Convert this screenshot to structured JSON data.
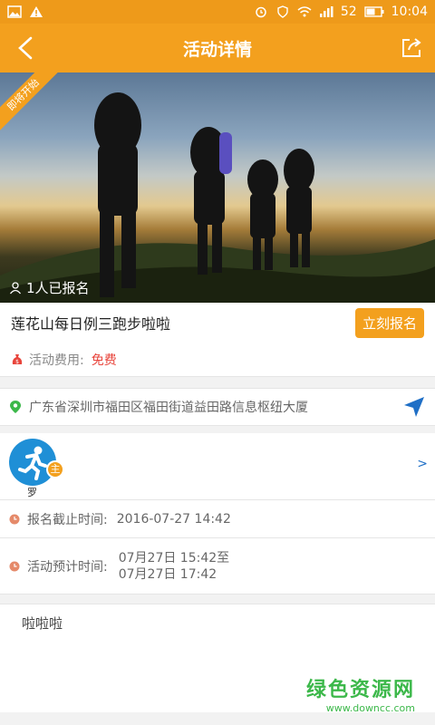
{
  "status_bar": {
    "battery": "52",
    "time": "10:04"
  },
  "header": {
    "title": "活动详情"
  },
  "hero": {
    "ribbon": "即将开始",
    "signed_count_text": "1人已报名"
  },
  "event": {
    "name": "莲花山每日例三跑步啦啦",
    "signup_label": "立刻报名",
    "fee_label": "活动费用:",
    "fee_value": "免费"
  },
  "location": {
    "address": "广东省深圳市福田区福田街道益田路信息枢纽大厦"
  },
  "host": {
    "badge": "主",
    "name": "罗",
    "chevron": ">"
  },
  "deadline": {
    "label": "报名截止时间:",
    "value": "2016-07-27 14:42"
  },
  "schedule": {
    "label": "活动预计时间:",
    "start": "07月27日 15:42至",
    "end": "07月27日 17:42"
  },
  "description": "啦啦啦",
  "watermark": {
    "title": "绿色资源网",
    "url": "www.downcc.com"
  },
  "colors": {
    "accent": "#f3a01e",
    "free": "#e8453c",
    "avatar": "#1f8fd6",
    "nav": "#1f6fc6"
  }
}
